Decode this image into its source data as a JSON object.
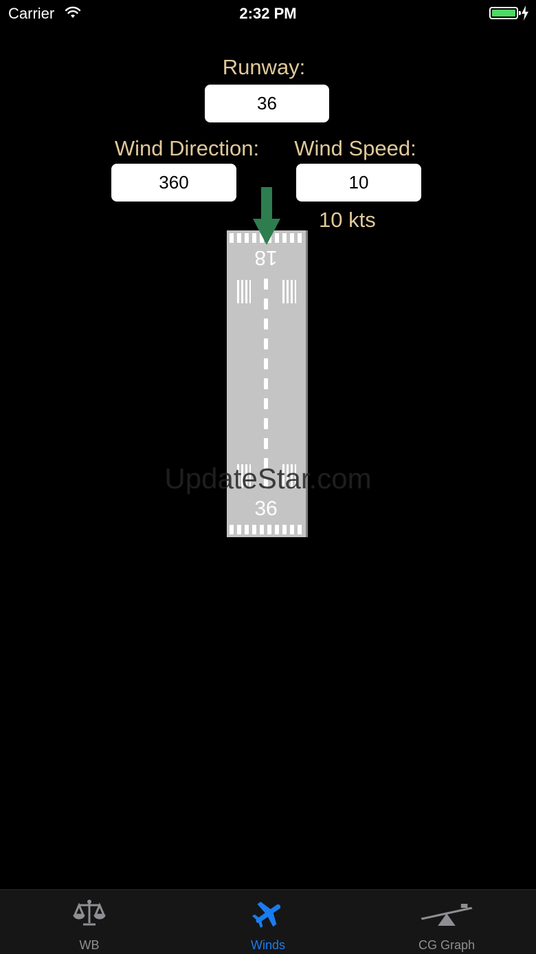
{
  "status_bar": {
    "carrier": "Carrier",
    "time": "2:32 PM",
    "battery_color": "#4cd964"
  },
  "runway": {
    "label": "Runway:",
    "value": "36"
  },
  "wind_direction": {
    "label": "Wind Direction:",
    "value": "360"
  },
  "wind_speed": {
    "label": "Wind Speed:",
    "value": "10",
    "readout": "10 kts"
  },
  "runway_diagram": {
    "top_number": "18",
    "bottom_number": "36",
    "wind_arrow_color": "#2e7d4f",
    "wind_arrow_icon": "arrow-down-icon"
  },
  "watermark": "UpdateStar.com",
  "tabs": [
    {
      "label": "WB",
      "icon": "scale-icon",
      "active": false
    },
    {
      "label": "Winds",
      "icon": "airplane-icon",
      "active": true
    },
    {
      "label": "CG Graph",
      "icon": "seesaw-icon",
      "active": false
    }
  ],
  "colors": {
    "label_text": "#e0c89a",
    "active_tab": "#1a7cf0",
    "inactive_tab": "#8e8e93"
  }
}
